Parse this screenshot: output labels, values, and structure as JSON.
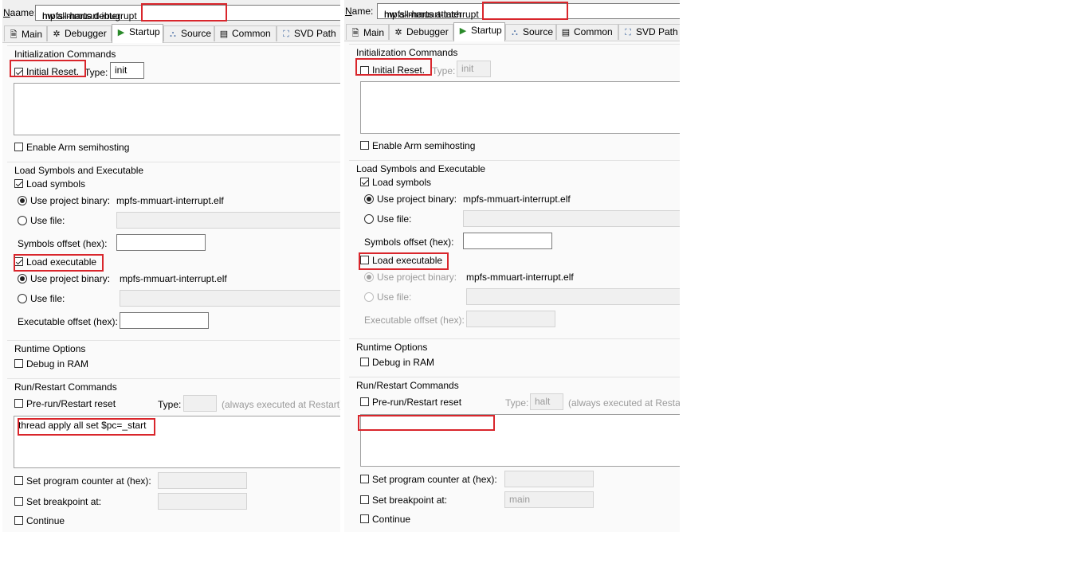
{
  "name_label": "Name:",
  "tabs": [
    "Main",
    "Debugger",
    "Startup",
    "Source",
    "Common",
    "SVD Path"
  ],
  "tab_icons": [
    "doc-icon",
    "bug-icon",
    "play-icon",
    "source-icon",
    "common-icon",
    "svd-icon"
  ],
  "labels": {
    "init_commands": "Initialization Commands",
    "initial_reset": "Initial Reset.",
    "type": "Type:",
    "semihosting": "Enable Arm semihosting",
    "load_group": "Load Symbols and Executable",
    "load_symbols": "Load symbols",
    "use_project_binary": "Use project binary:",
    "use_file": "Use file:",
    "symbols_offset": "Symbols offset (hex):",
    "load_executable": "Load executable",
    "executable_offset": "Executable offset (hex):",
    "runtime_options": "Runtime Options",
    "debug_in_ram": "Debug in RAM",
    "run_restart": "Run/Restart Commands",
    "prerun": "Pre-run/Restart reset",
    "always_restart": "(always executed at Restart)",
    "set_pc": "Set program counter at (hex):",
    "set_breakpoint": "Set breakpoint at:",
    "continue": "Continue"
  },
  "left": {
    "name_prefix": "mpfs-mmuart-interrupt",
    "name_suffix": "hw all-harts debug",
    "init_type": "init",
    "symbols_binary": "mpfs-mmuart-interrupt.elf",
    "exec_binary": "mpfs-mmuart-interrupt.elf",
    "prerun_type": "",
    "run_command": "thread apply all set $pc=_start",
    "breakpoint": ""
  },
  "right": {
    "name_prefix": "mpfs-mmuart-interrupt",
    "name_suffix": "hw all-harts attach",
    "init_type": "init",
    "symbols_binary": "mpfs-mmuart-interrupt.elf",
    "exec_binary": "mpfs-mmuart-interrupt.elf",
    "prerun_type": "halt",
    "run_command": "",
    "breakpoint": "main"
  },
  "colors": {
    "highlight": "#d9262c",
    "accent_play": "#2a8a2a"
  }
}
